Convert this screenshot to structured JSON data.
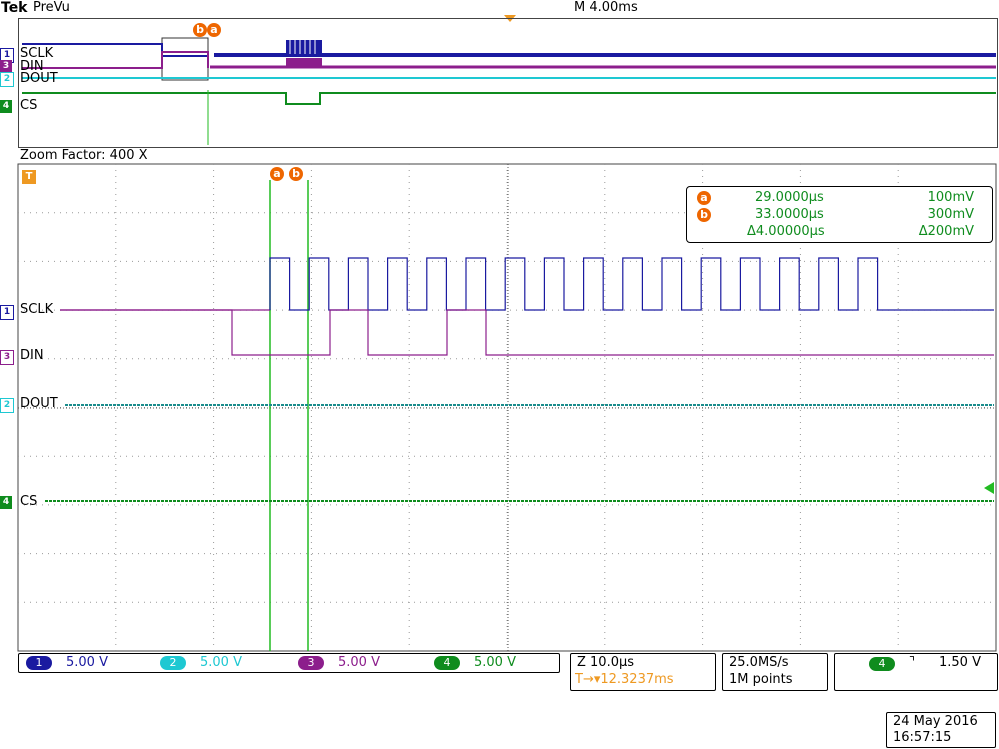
{
  "header": {
    "brand": "Tek",
    "mode": "PreVu",
    "timebase": "M 4.00ms"
  },
  "zoom": {
    "label": "Zoom Factor: 400 X"
  },
  "cursors": {
    "a": {
      "marker": "a",
      "time": "29.0000µs",
      "volt": "100mV"
    },
    "b": {
      "marker": "b",
      "time": "33.0000µs",
      "volt": "300mV"
    },
    "delta": {
      "time": "Δ4.00000µs",
      "volt": "Δ200mV"
    }
  },
  "channels": [
    {
      "num": "1",
      "label": "SCLK",
      "scale": "5.00 V",
      "color": "#1a1aa0"
    },
    {
      "num": "2",
      "label": "DOUT",
      "scale": "5.00 V",
      "color": "#1ec8d2"
    },
    {
      "num": "3",
      "label": "DIN",
      "scale": "5.00 V",
      "color": "#8c1e8c"
    },
    {
      "num": "4",
      "label": "CS",
      "scale": "5.00 V",
      "color": "#0f8c1e"
    }
  ],
  "overview_labels": {
    "ch1": "SCLK",
    "ch3": "DIN",
    "ch2": "DOUT",
    "ch4": "CS"
  },
  "trigger_marker": "T",
  "zoom_info": {
    "zoom": "Z 10.0µs",
    "position": "T→▾12.3237ms"
  },
  "acquisition": {
    "rate": "25.0MS/s",
    "points": "1M points"
  },
  "trigger": {
    "channel": "4",
    "slope": "⌝",
    "level": "1.50 V"
  },
  "datetime": {
    "date": "24 May 2016",
    "time": "16:57:15"
  },
  "colors": {
    "cursor": "#22bb22",
    "orange": "#ee6600",
    "grid": "#888888"
  }
}
